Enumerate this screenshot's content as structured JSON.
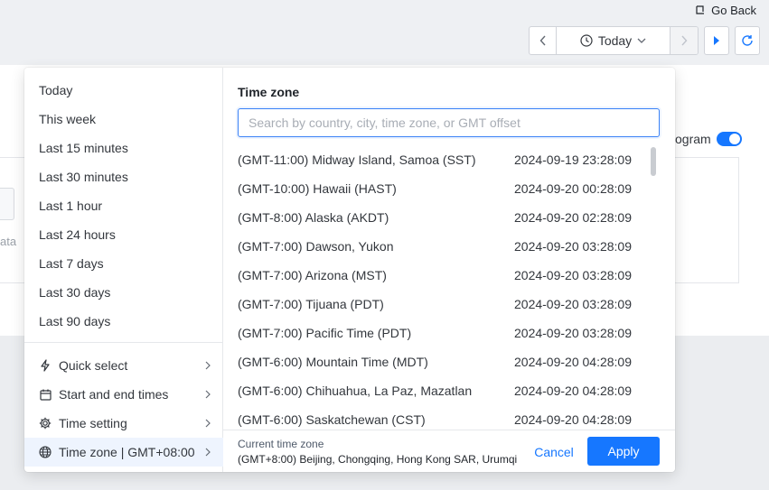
{
  "header": {
    "go_back": "Go Back",
    "today_label": "Today"
  },
  "background": {
    "histogram_label": "ogram",
    "no_data_fragment": "ata"
  },
  "presets": [
    {
      "label": "Today"
    },
    {
      "label": "This week"
    },
    {
      "label": "Last 15 minutes"
    },
    {
      "label": "Last 30 minutes"
    },
    {
      "label": "Last 1 hour"
    },
    {
      "label": "Last 24 hours"
    },
    {
      "label": "Last 7 days"
    },
    {
      "label": "Last 30 days"
    },
    {
      "label": "Last 90 days"
    }
  ],
  "menu": [
    {
      "label": "Quick select",
      "icon": "lightning-icon"
    },
    {
      "label": "Start and end times",
      "icon": "calendar-icon"
    },
    {
      "label": "Time setting",
      "icon": "gear-icon"
    },
    {
      "label": "Time zone | GMT+08:00",
      "icon": "globe-icon"
    }
  ],
  "timezone": {
    "title": "Time zone",
    "search_placeholder": "Search by country, city, time zone, or GMT offset",
    "rows": [
      {
        "name": "(GMT-11:00) Midway Island, Samoa (SST)",
        "time": "2024-09-19 23:28:09"
      },
      {
        "name": "(GMT-10:00) Hawaii (HAST)",
        "time": "2024-09-20 00:28:09"
      },
      {
        "name": "(GMT-8:00) Alaska (AKDT)",
        "time": "2024-09-20 02:28:09"
      },
      {
        "name": "(GMT-7:00) Dawson, Yukon",
        "time": "2024-09-20 03:28:09"
      },
      {
        "name": "(GMT-7:00) Arizona (MST)",
        "time": "2024-09-20 03:28:09"
      },
      {
        "name": "(GMT-7:00) Tijuana (PDT)",
        "time": "2024-09-20 03:28:09"
      },
      {
        "name": "(GMT-7:00) Pacific Time (PDT)",
        "time": "2024-09-20 03:28:09"
      },
      {
        "name": "(GMT-6:00) Mountain Time (MDT)",
        "time": "2024-09-20 04:28:09"
      },
      {
        "name": "(GMT-6:00) Chihuahua, La Paz, Mazatlan",
        "time": "2024-09-20 04:28:09"
      },
      {
        "name": "(GMT-6:00) Saskatchewan (CST)",
        "time": "2024-09-20 04:28:09"
      }
    ],
    "current_label": "Current time zone",
    "current_value": "(GMT+8:00) Beijing, Chongqing, Hong Kong SAR, Urumqi",
    "cancel_label": "Cancel",
    "apply_label": "Apply"
  },
  "colors": {
    "accent": "#1677ff",
    "active_menu_bg": "#eef4fe"
  }
}
